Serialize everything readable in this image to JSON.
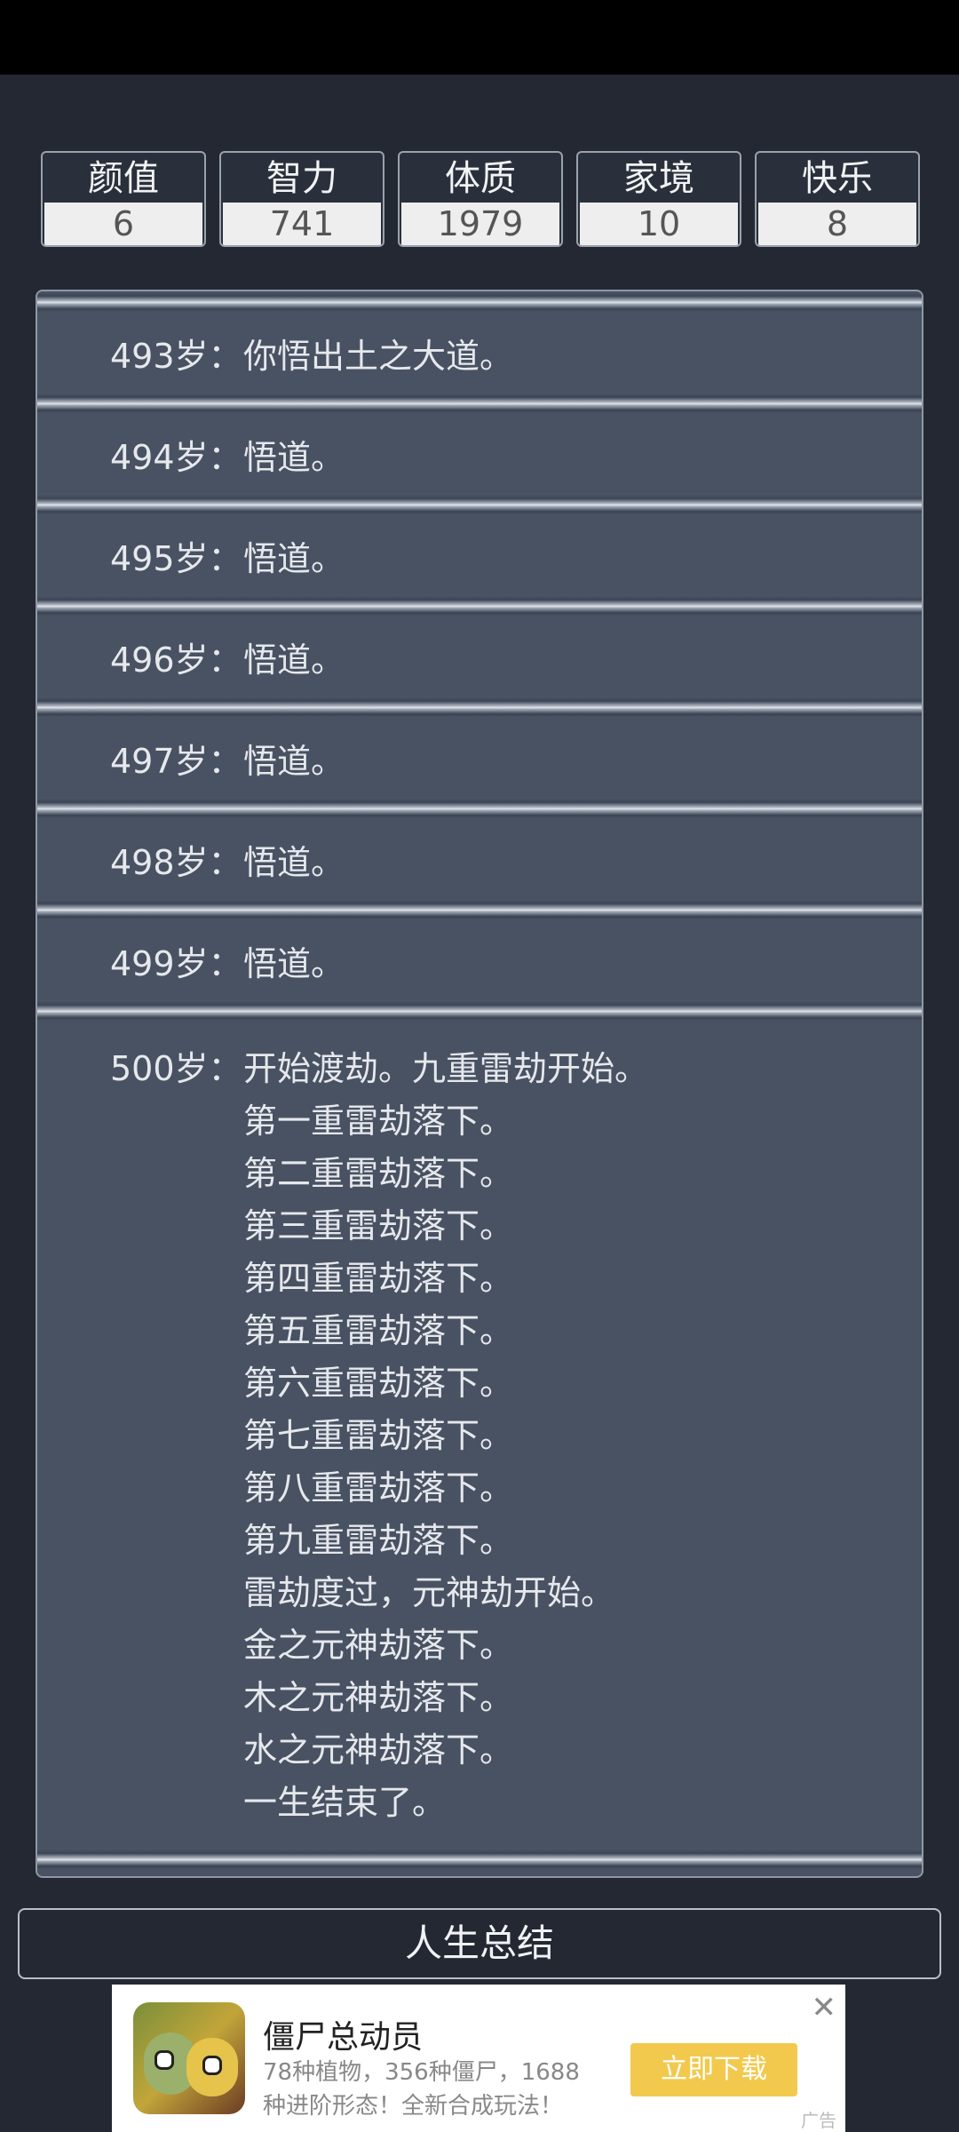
{
  "stats": [
    {
      "label": "颜值",
      "value": "6"
    },
    {
      "label": "智力",
      "value": "741"
    },
    {
      "label": "体质",
      "value": "1979"
    },
    {
      "label": "家境",
      "value": "10"
    },
    {
      "label": "快乐",
      "value": "8"
    }
  ],
  "log": [
    {
      "age": "493岁：",
      "text": "你悟出土之大道。"
    },
    {
      "age": "494岁：",
      "text": "悟道。"
    },
    {
      "age": "495岁：",
      "text": "悟道。"
    },
    {
      "age": "496岁：",
      "text": "悟道。"
    },
    {
      "age": "497岁：",
      "text": "悟道。"
    },
    {
      "age": "498岁：",
      "text": "悟道。"
    },
    {
      "age": "499岁：",
      "text": "悟道。"
    }
  ],
  "final_entry": {
    "age": "500岁：",
    "lines": [
      "开始渡劫。九重雷劫开始。",
      "第一重雷劫落下。",
      "第二重雷劫落下。",
      "第三重雷劫落下。",
      "第四重雷劫落下。",
      "第五重雷劫落下。",
      "第六重雷劫落下。",
      "第七重雷劫落下。",
      "第八重雷劫落下。",
      "第九重雷劫落下。",
      "雷劫度过，元神劫开始。",
      "金之元神劫落下。",
      "木之元神劫落下。",
      "水之元神劫落下。",
      "一生结束了。"
    ]
  },
  "summary_button": "人生总结",
  "ad": {
    "title": "僵尸总动员",
    "desc": "78种植物，356种僵尸，1688种进阶形态！全新合成玩法！",
    "button": "立即下载",
    "close": "✕",
    "tag": "广告"
  }
}
